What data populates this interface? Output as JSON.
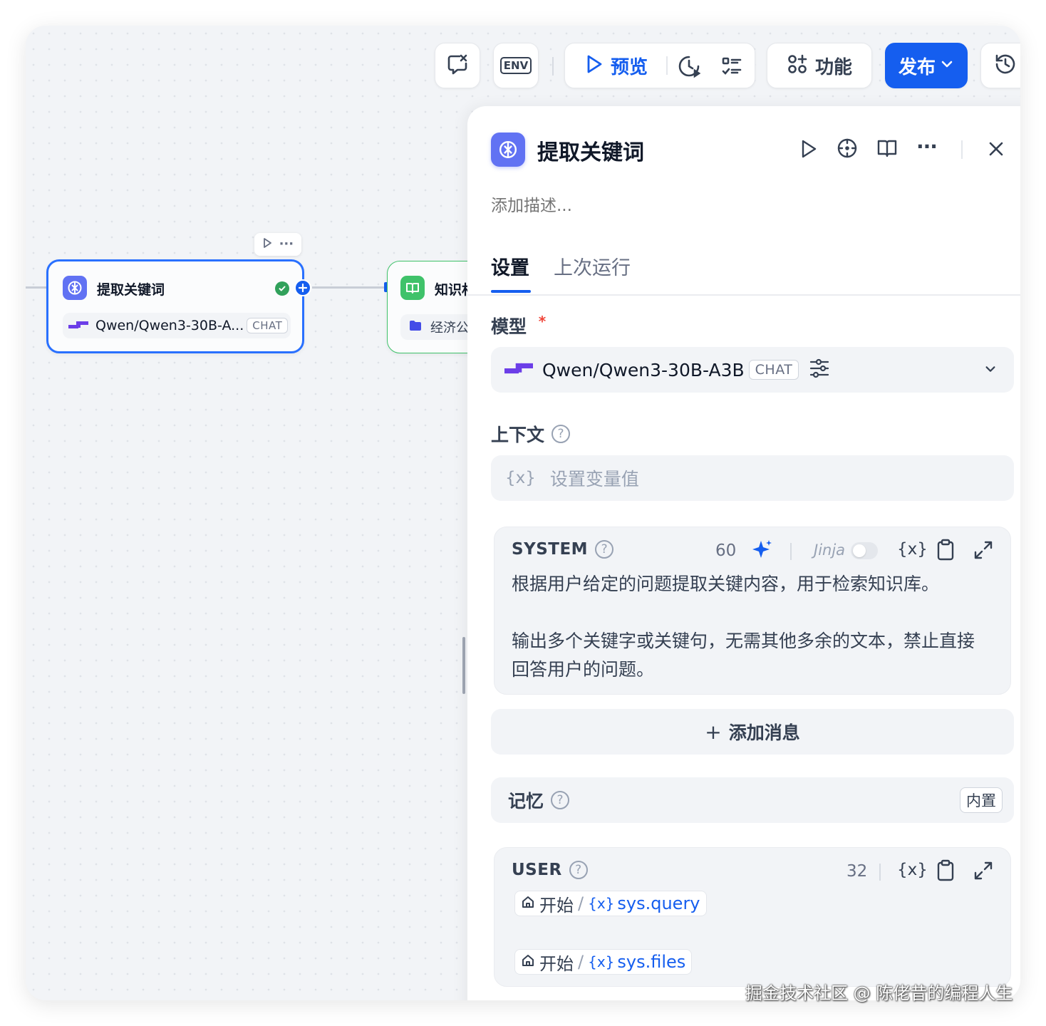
{
  "toolbar": {
    "env_label": "ENV",
    "preview_label": "预览",
    "features_label": "功能",
    "publish_label": "发布"
  },
  "canvas": {
    "node1": {
      "title": "提取关键词",
      "model_name": "Qwen/Qwen3-30B-A...",
      "model_badge": "CHAT"
    },
    "node2": {
      "title": "知识村",
      "row_text": "经济公"
    }
  },
  "panel": {
    "title": "提取关键词",
    "description_placeholder": "添加描述...",
    "tabs": [
      {
        "label": "设置"
      },
      {
        "label": "上次运行"
      }
    ],
    "model": {
      "label": "模型",
      "required_mark": "*",
      "name": "Qwen/Qwen3-30B-A3B",
      "badge": "CHAT"
    },
    "context": {
      "label": "上下文",
      "var_icon": "{x}",
      "placeholder": "设置变量值"
    },
    "system": {
      "label": "SYSTEM",
      "count": "60",
      "jinja_label": "Jinja",
      "var_icon": "{x}",
      "line1": "根据用户给定的问题提取关键内容，用于检索知识库。",
      "line2": "输出多个关键字或关键句，无需其他多余的文本，禁止直接",
      "line3": "回答用户的问题。"
    },
    "add_message": {
      "plus": "+",
      "label": "添加消息"
    },
    "memory": {
      "label": "记忆",
      "badge": "内置"
    },
    "user": {
      "label": "USER",
      "count": "32",
      "var_icon": "{x}",
      "chips": [
        {
          "source": "开始",
          "sep": "/",
          "var_icon": "{x}",
          "var": "sys.query"
        },
        {
          "source": "开始",
          "sep": "/",
          "var_icon": "{x}",
          "var": "sys.files"
        }
      ]
    }
  },
  "watermark": "掘金技术社区 @ 陈佬昔的编程人生",
  "colors": {
    "accent": "#155eef",
    "node_border": "#2970ff",
    "node_icon": "#6172f3",
    "knowledge_icon": "#3fc26a",
    "success": "#31a15b",
    "text": "#354052",
    "placeholder": "#98a2b3"
  }
}
